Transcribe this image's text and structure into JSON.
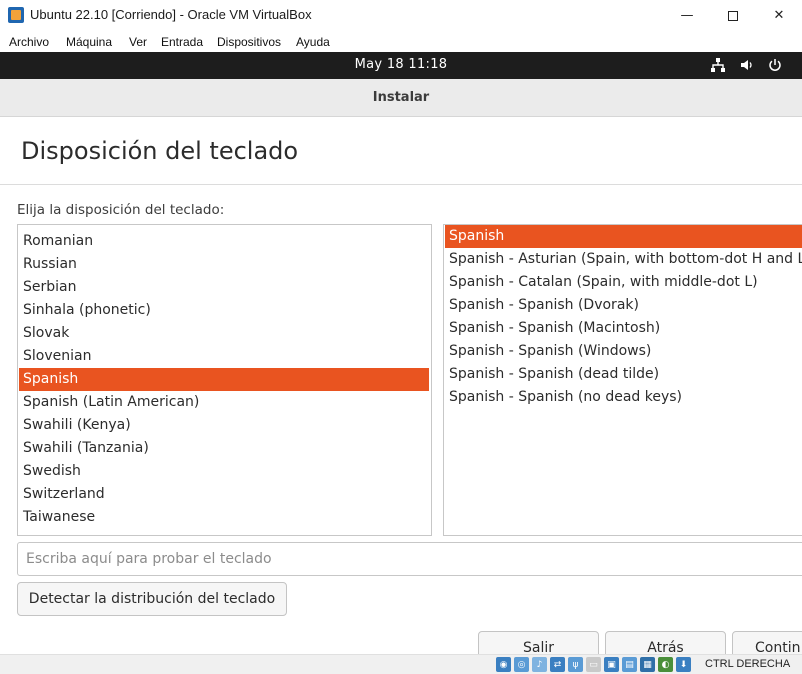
{
  "window": {
    "title": "Ubuntu 22.10 [Corriendo] - Oracle VM VirtualBox",
    "minimize_glyph": "—",
    "close_glyph": "✕"
  },
  "menubar": {
    "items": [
      "Archivo",
      "Máquina",
      "Ver",
      "Entrada",
      "Dispositivos",
      "Ayuda"
    ]
  },
  "topbar": {
    "clock": "May 18  11:18",
    "icons": [
      "network-icon",
      "volume-icon",
      "power-icon"
    ]
  },
  "installer": {
    "header_title": "Instalar",
    "page_title": "Disposición del teclado",
    "prompt": "Elija la disposición del teclado:",
    "layouts": [
      "Romanian",
      "Russian",
      "Serbian",
      "Sinhala (phonetic)",
      "Slovak",
      "Slovenian",
      "Spanish",
      "Spanish (Latin American)",
      "Swahili (Kenya)",
      "Swahili (Tanzania)",
      "Swedish",
      "Switzerland",
      "Taiwanese"
    ],
    "selected_layout": "Spanish",
    "variants": [
      "Spanish",
      "Spanish - Asturian (Spain, with bottom-dot H and L)",
      "Spanish - Catalan (Spain, with middle-dot L)",
      "Spanish - Spanish (Dvorak)",
      "Spanish - Spanish (Macintosh)",
      "Spanish - Spanish (Windows)",
      "Spanish - Spanish (dead tilde)",
      "Spanish - Spanish (no dead keys)"
    ],
    "selected_variant": "Spanish",
    "test_input": {
      "placeholder": "Escriba aquí para probar el teclado",
      "value": ""
    },
    "detect_button": "Detectar la distribución del teclado",
    "buttons": {
      "quit": "Salir",
      "back": "Atrás",
      "continue": "Contin"
    },
    "accent_color": "#e95420"
  },
  "statusbar": {
    "host_key": "CTRL DERECHA"
  }
}
